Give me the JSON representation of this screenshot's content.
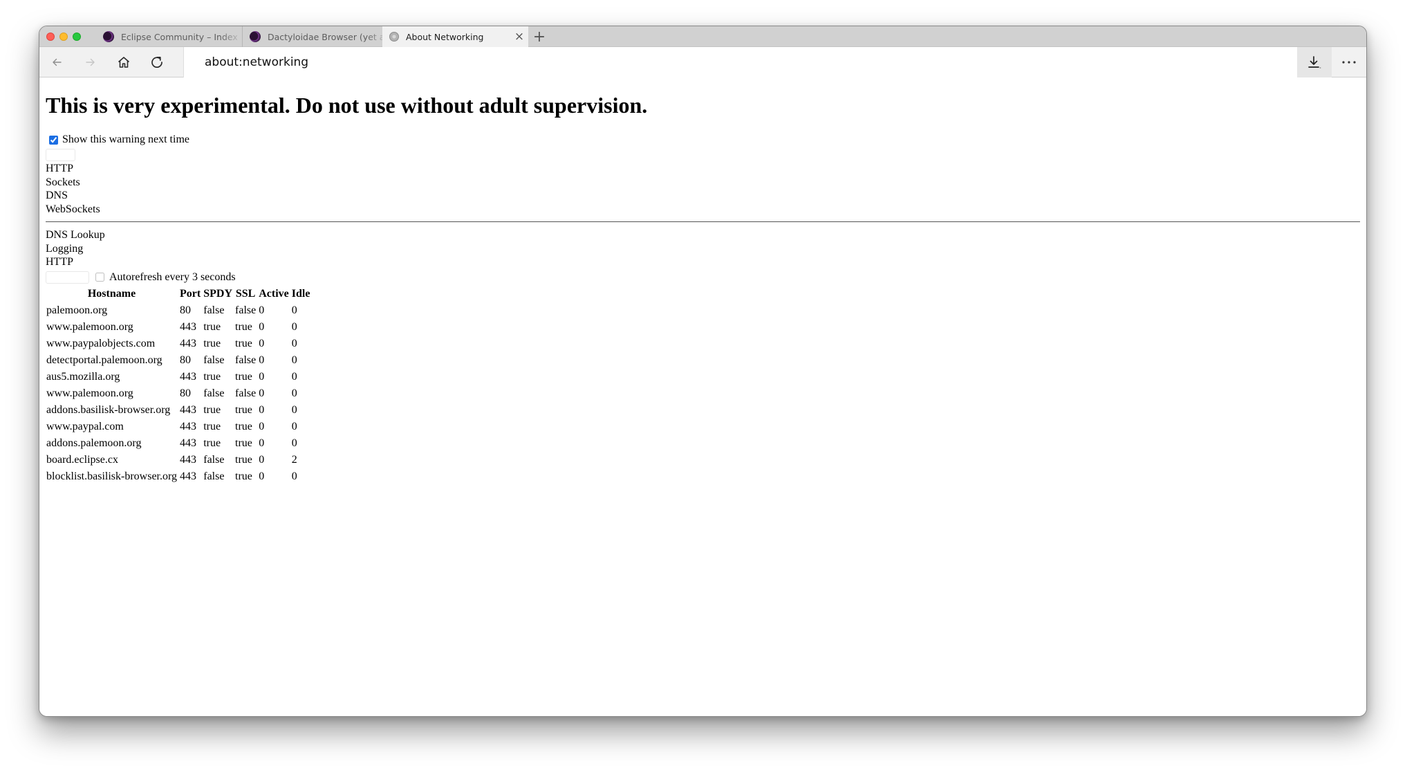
{
  "browser": {
    "tabs": [
      {
        "label": "Eclipse Community – Index",
        "icon": "eclipse-icon",
        "active": false
      },
      {
        "label": "Dactyloidae Browser (yet another",
        "icon": "eclipse-icon",
        "active": false
      },
      {
        "label": "About Networking",
        "icon": "globe-icon",
        "active": true
      }
    ],
    "close_tab_glyph": "×",
    "new_tab_glyph": "+",
    "url": "about:networking"
  },
  "page": {
    "heading": "This is very experimental. Do not use without adult supervision.",
    "warning_checkbox_label": "Show this warning next time",
    "warning_checked": true,
    "categories": [
      "HTTP",
      "Sockets",
      "DNS",
      "WebSockets"
    ],
    "subsections": [
      "DNS Lookup",
      "Logging",
      "HTTP"
    ],
    "autorefresh_label": "Autorefresh every 3 seconds",
    "autorefresh_checked": false,
    "http_table": {
      "headers": [
        "Hostname",
        "Port",
        "SPDY",
        "SSL",
        "Active",
        "Idle"
      ],
      "rows": [
        [
          "palemoon.org",
          "80",
          "false",
          "false",
          "0",
          "0"
        ],
        [
          "www.palemoon.org",
          "443",
          "true",
          "true",
          "0",
          "0"
        ],
        [
          "www.paypalobjects.com",
          "443",
          "true",
          "true",
          "0",
          "0"
        ],
        [
          "detectportal.palemoon.org",
          "80",
          "false",
          "false",
          "0",
          "0"
        ],
        [
          "aus5.mozilla.org",
          "443",
          "true",
          "true",
          "0",
          "0"
        ],
        [
          "www.palemoon.org",
          "80",
          "false",
          "false",
          "0",
          "0"
        ],
        [
          "addons.basilisk-browser.org",
          "443",
          "true",
          "true",
          "0",
          "0"
        ],
        [
          "www.paypal.com",
          "443",
          "true",
          "true",
          "0",
          "0"
        ],
        [
          "addons.palemoon.org",
          "443",
          "true",
          "true",
          "0",
          "0"
        ],
        [
          "board.eclipse.cx",
          "443",
          "false",
          "true",
          "0",
          "2"
        ],
        [
          "blocklist.basilisk-browser.org",
          "443",
          "false",
          "true",
          "0",
          "0"
        ]
      ]
    }
  }
}
